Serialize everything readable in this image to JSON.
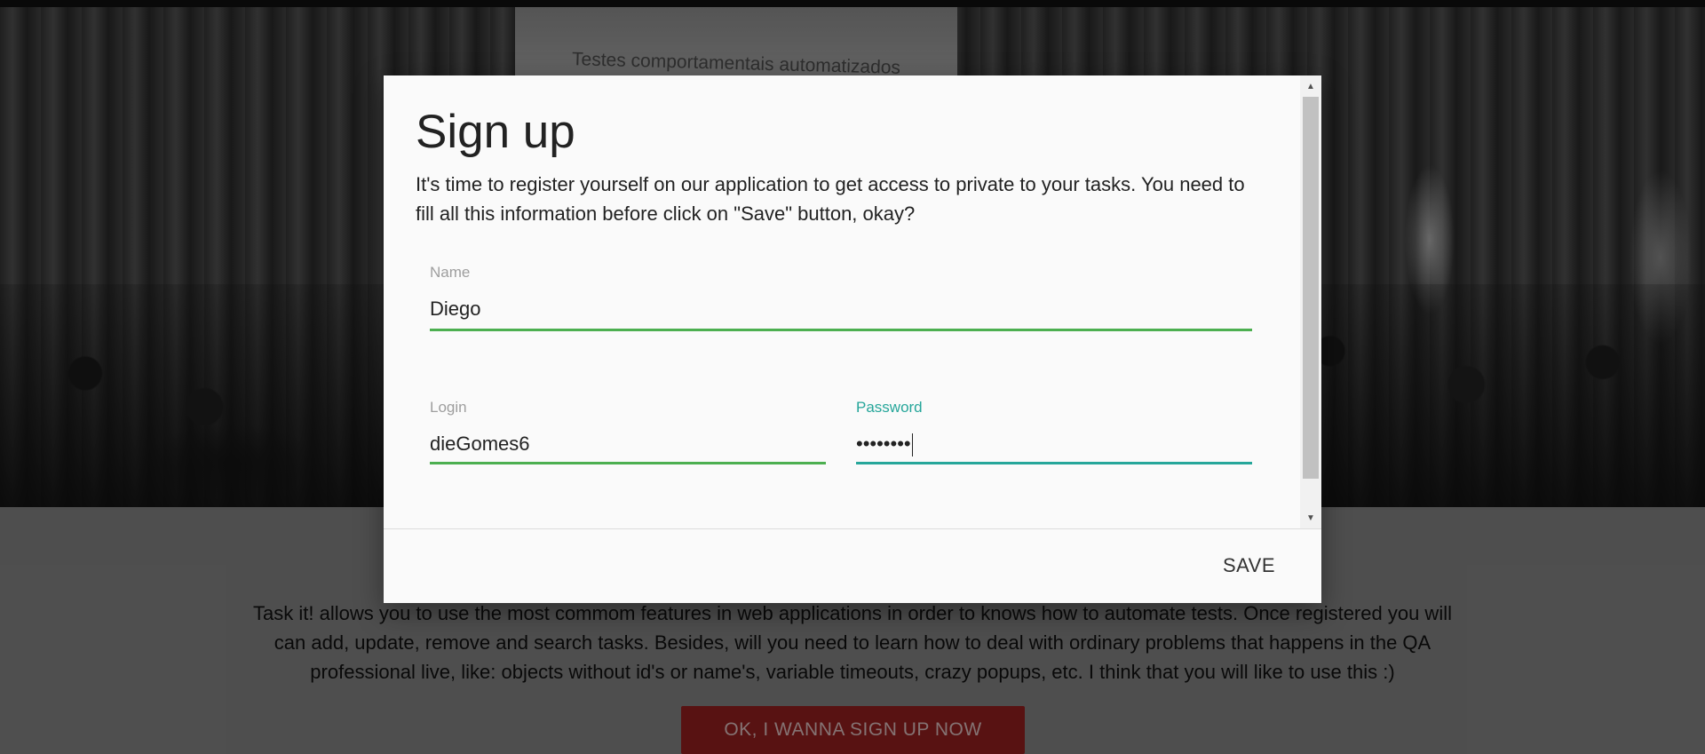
{
  "background": {
    "screen_text": "Testes comportamentais automatizados",
    "intro_text": "Task it! allows you to use the most commom features in web applications in order to knows how to automate tests. Once registered you will can add, update, remove and search tasks. Besides, will you need to learn how to deal with ordinary problems that happens in the QA professional live, like: objects without id's or name's, variable timeouts, crazy popups, etc. I think that you will like to use this :)",
    "cta_label": "OK, I WANNA SIGN UP NOW"
  },
  "modal": {
    "title": "Sign up",
    "description": "It's time to register yourself on our application to get access to private to your tasks. You need to fill all this information before click on \"Save\" button, okay?",
    "fields": {
      "name": {
        "label": "Name",
        "value": "Diego"
      },
      "login": {
        "label": "Login",
        "value": "dieGomes6"
      },
      "password": {
        "label": "Password",
        "value": "••••••••"
      }
    },
    "save_label": "SAVE"
  },
  "colors": {
    "field_underline": "#4caf50",
    "active_field": "#26a69a",
    "cta_background": "#a02222"
  }
}
